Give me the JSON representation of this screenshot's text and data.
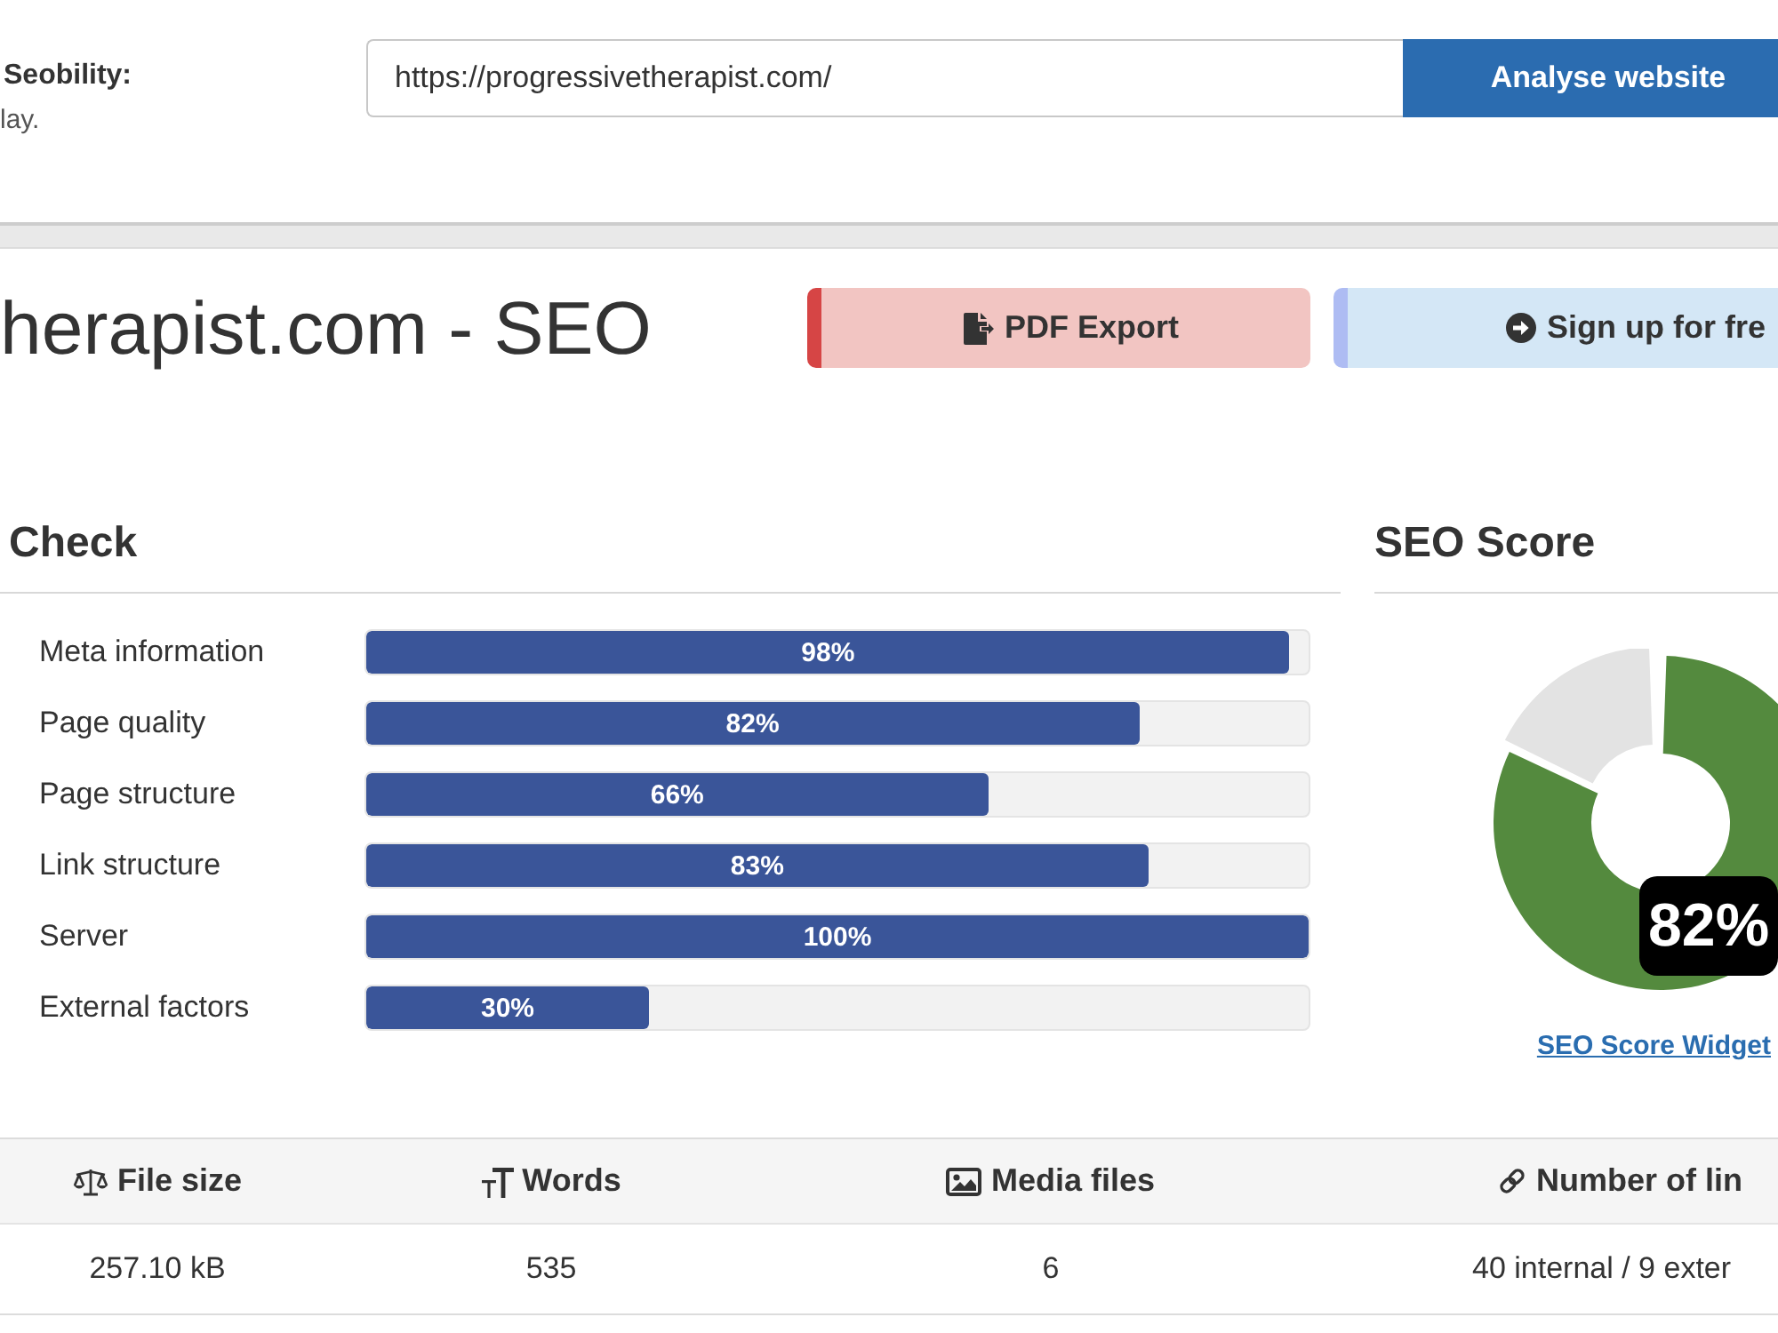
{
  "header": {
    "intro_title": "Seobility:",
    "intro_text": "lay.",
    "url_field": {
      "value": "https://progressivetherapist.com/"
    },
    "analyse_button": "Analyse website"
  },
  "report": {
    "title": "herapist.com - SEO",
    "buttons": [
      {
        "label": "PDF Export",
        "kind": "pdf"
      },
      {
        "label": "Sign up for fre",
        "kind": "signup"
      }
    ]
  },
  "check": {
    "title": "Check",
    "items": [
      {
        "label": "Meta information",
        "level": 0.98,
        "reading": "98%"
      },
      {
        "label": "Page quality",
        "level": 0.82,
        "reading": "82%"
      },
      {
        "label": "Page structure",
        "level": 0.66,
        "reading": "66%"
      },
      {
        "label": "Link structure",
        "level": 0.83,
        "reading": "83%"
      },
      {
        "label": "Server",
        "level": 1,
        "reading": "100%"
      },
      {
        "label": "External factors",
        "level": 0.3,
        "reading": "30%"
      }
    ]
  },
  "seo_score": {
    "title": "SEO Score",
    "chart_data": {
      "type": "donut",
      "values": [
        82,
        18
      ],
      "value_labels": [
        "82%",
        null
      ]
    },
    "link": "SEO Score Widget"
  },
  "stats": {
    "columns": [
      {
        "label": "File size",
        "kind": "scale"
      },
      {
        "label": "Words",
        "kind": "text"
      },
      {
        "label": "Media files",
        "kind": "image"
      },
      {
        "label": "Number of lin",
        "kind": "link"
      }
    ],
    "rows": [
      [
        "257.10 kB",
        "535",
        "6",
        "40 internal / 9 exter"
      ]
    ]
  }
}
